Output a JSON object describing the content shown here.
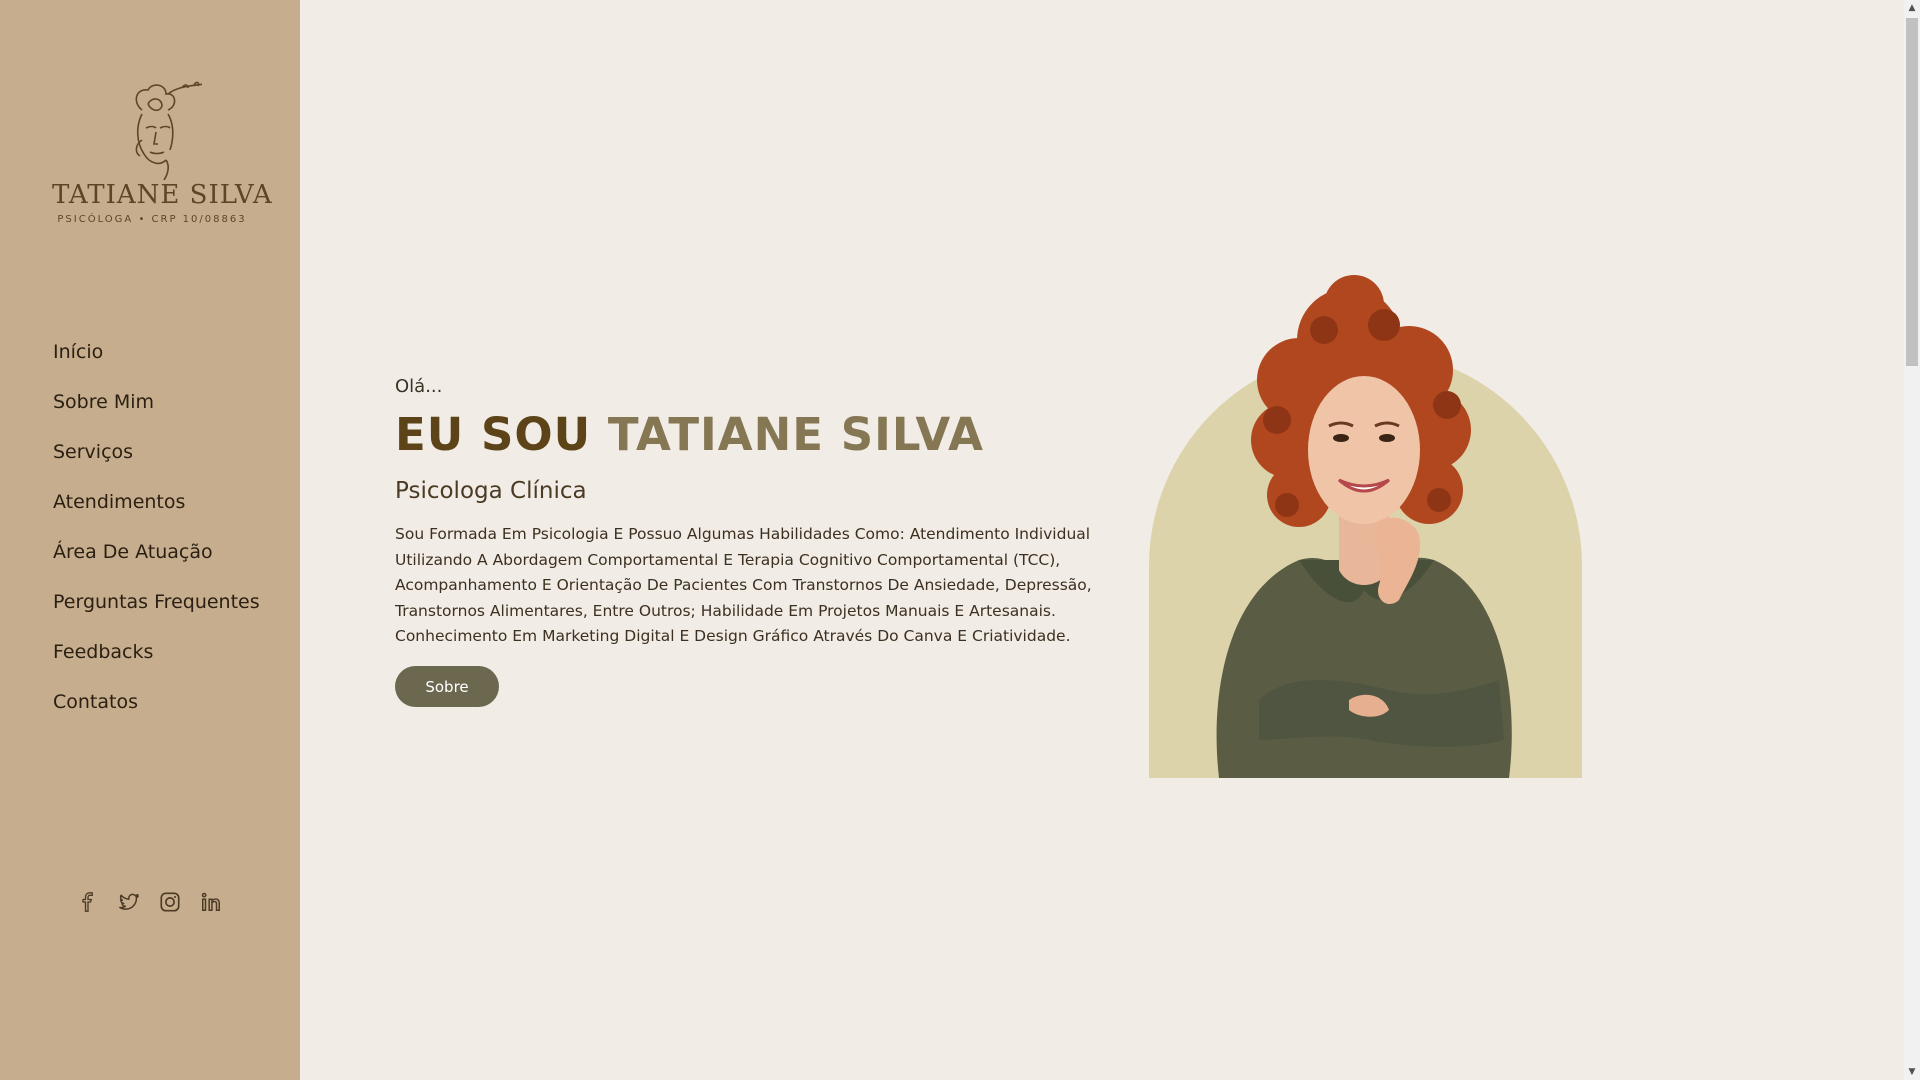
{
  "brand": {
    "name": "TATIANE SILVA",
    "tagline": "PSICÓLOGA • CRP 10/08863"
  },
  "nav": {
    "items": [
      {
        "label": "Início"
      },
      {
        "label": "Sobre Mim"
      },
      {
        "label": "Serviços"
      },
      {
        "label": "Atendimentos"
      },
      {
        "label": "Área De Atuação"
      },
      {
        "label": "Perguntas Frequentes"
      },
      {
        "label": "Feedbacks"
      },
      {
        "label": "Contatos"
      }
    ]
  },
  "social": [
    "facebook-icon",
    "twitter-icon",
    "instagram-icon",
    "linkedin-icon"
  ],
  "hero": {
    "greeting": "Olá...",
    "headline_part1": "EU SOU",
    "headline_part2": "TATIANE SILVA",
    "subtitle": "Psicologa Clínica",
    "description": "Sou Formada Em Psicologia E Possuo Algumas Habilidades Como: Atendimento Individual Utilizando A Abordagem Comportamental E Terapia Cognitivo Comportamental (TCC), Acompanhamento E Orientação De Pacientes Com Transtornos De Ansiedade, Depressão, Transtornos Alimentares, Entre Outros; Habilidade Em Projetos Manuais E Artesanais. Conhecimento Em Marketing Digital E Design Gráfico Através Do Canva E Criatividade.",
    "button_label": "Sobre"
  },
  "colors": {
    "sidebar": "#c6ad8d",
    "background": "#f1ece6",
    "headline_dark": "#5c4318",
    "headline_light": "#857754",
    "button": "#6b684f",
    "arch": "#dcd3ab"
  }
}
